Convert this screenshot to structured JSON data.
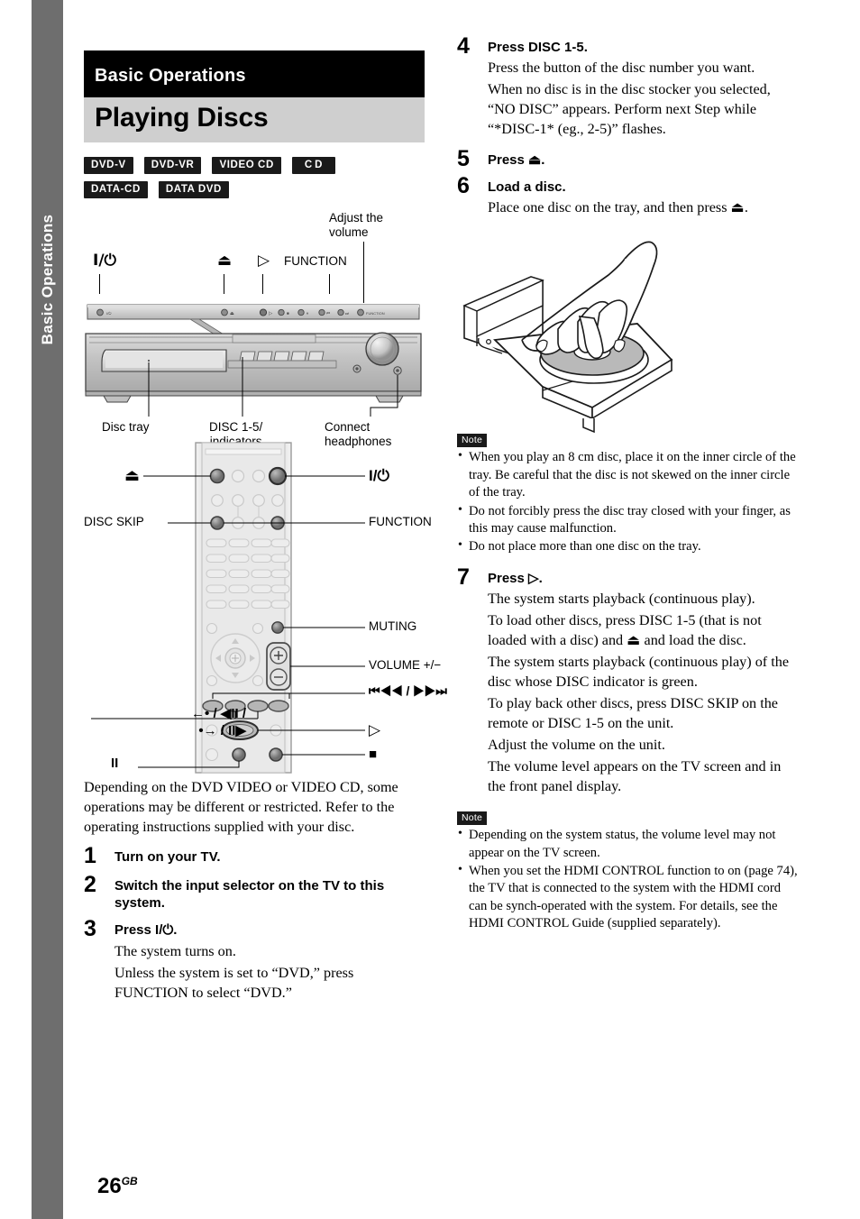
{
  "sidebar": {
    "label": "Basic Operations"
  },
  "header": {
    "chapter": "Basic Operations",
    "title": "Playing Discs"
  },
  "disc_badges": [
    "DVD-V",
    "DVD-VR",
    "VIDEO CD",
    "CD",
    "DATA-CD",
    "DATA DVD"
  ],
  "front_panel_figure": {
    "top_labels": {
      "power": "I/⏻",
      "eject": "⏏",
      "play": "▷",
      "function": "FUNCTION",
      "volume": "Adjust the\nvolume",
      "volume_line1": "Adjust the",
      "volume_line2": "volume"
    },
    "bottom_labels": {
      "disc_tray": "Disc tray",
      "disc_indicators_line1": "DISC 1-5/",
      "disc_indicators_line2": "indicators",
      "headphones_line1": "Connect",
      "headphones_line2": "headphones"
    }
  },
  "remote_figure": {
    "labels": {
      "eject": "⏏",
      "power": "I/⏻",
      "disc_skip": "DISC SKIP",
      "function": "FUNCTION",
      "muting": "MUTING",
      "volume": "VOLUME +/−",
      "skip": "⏮◀◀ / ▶▶⏭",
      "scan_line1": "←• / ◀II /",
      "scan_line2": "•→ / II▶",
      "play": "▷",
      "stop": "■",
      "pause": "II"
    }
  },
  "intro_paragraph": "Depending on the DVD VIDEO or VIDEO CD, some operations may be different or restricted. Refer to the operating instructions supplied with your disc.",
  "steps_left": [
    {
      "num": "1",
      "head": "Turn on your TV.",
      "paras": []
    },
    {
      "num": "2",
      "head": "Switch the input selector on the TV to this system.",
      "paras": []
    },
    {
      "num": "3",
      "head": "Press I/⏻.",
      "paras": [
        "The system turns on.",
        "Unless the system is set to “DVD,” press FUNCTION to select “DVD.”"
      ]
    }
  ],
  "steps_right": [
    {
      "num": "4",
      "head": "Press DISC 1-5.",
      "paras": [
        "Press the button of the disc number you want.",
        "When no disc is in the disc stocker you selected, “NO DISC” appears. Perform next Step while “*DISC-1* (eg., 2-5)” flashes."
      ]
    },
    {
      "num": "5",
      "head": "Press ⏏.",
      "paras": []
    },
    {
      "num": "6",
      "head": "Load a disc.",
      "paras": [
        "Place one disc on the tray, and then press ⏏."
      ]
    },
    {
      "num": "7",
      "head": "Press ▷.",
      "paras": [
        "The system starts playback (continuous play).",
        "To load other discs, press DISC 1-5 (that is not loaded with a disc) and ⏏ and load the disc.",
        "The system starts playback (continuous play) of the disc whose DISC indicator is green.",
        "To play back other discs, press DISC SKIP on the remote or DISC 1-5 on the unit.",
        "Adjust the volume on the unit.",
        "The volume level appears on the TV screen and in the front panel display."
      ]
    }
  ],
  "note_tray": {
    "tag": "Note",
    "items": [
      "When you play an 8 cm disc, place it on the inner circle of the tray. Be careful that the disc is not skewed on the inner circle of the tray.",
      "Do not forcibly press the disc tray closed with your finger, as this may cause malfunction.",
      "Do not place more than one disc on the tray."
    ]
  },
  "note_volume": {
    "tag": "Note",
    "items": [
      "Depending on the system status, the volume level may not appear on the TV screen.",
      "When you set the HDMI CONTROL function to on (page 74), the TV that is connected to the system with the HDMI cord can be synch-operated with the system. For details, see the HDMI CONTROL Guide (supplied separately)."
    ]
  },
  "page_number": {
    "number": "26",
    "suffix": "GB"
  },
  "colors": {
    "chapter_bar": "#000000",
    "title_bar": "#cfcfcf",
    "side_tab": "#6e6e6e",
    "badge_bg": "#1a1a1a"
  }
}
